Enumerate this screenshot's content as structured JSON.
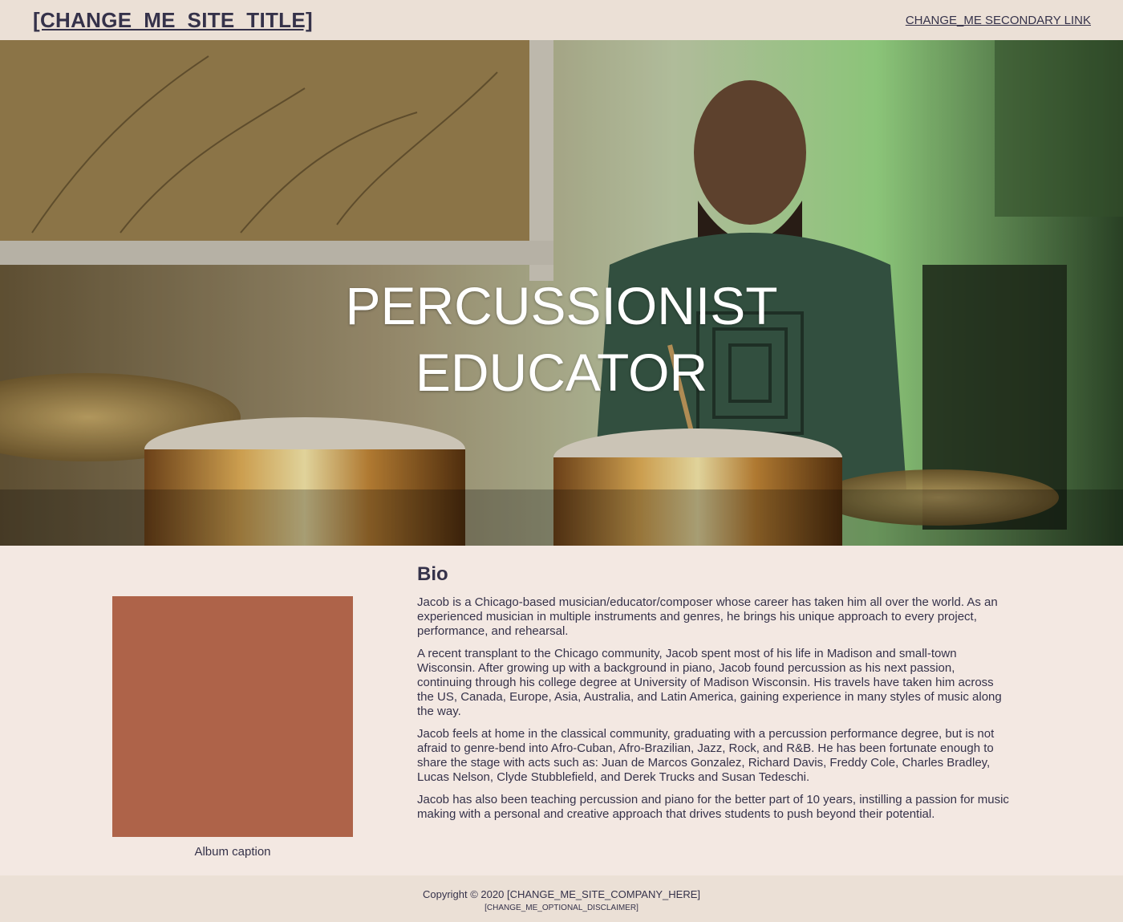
{
  "header": {
    "site_title": "[CHANGE_ME_SITE_TITLE]",
    "secondary_link": "CHANGE_ME SECONDARY LINK"
  },
  "hero": {
    "line1": "PERCUSSIONIST",
    "line2": "EDUCATOR"
  },
  "album": {
    "color": "#ae6349",
    "caption": "Album caption"
  },
  "bio": {
    "heading": "Bio",
    "paragraphs": [
      "Jacob is a Chicago-based musician/educator/composer whose career has taken him all over the world. As an experienced musician in multiple instruments and genres, he brings his unique approach to every project, performance, and rehearsal.",
      "A recent transplant to the Chicago community, Jacob spent most of his life in Madison and small-town Wisconsin. After growing up with a background in piano, Jacob found percussion as his next passion, continuing through his college degree at University of Madison Wisconsin. His travels have taken him across the US, Canada, Europe, Asia, Australia, and Latin America, gaining experience in many styles of music along the way.",
      "Jacob feels at home in the classical community, graduating with a percussion performance degree, but is not afraid to genre-bend into Afro-Cuban, Afro-Brazilian, Jazz, Rock, and R&B. He has been fortunate enough to share the stage with acts such as: Juan de Marcos Gonzalez, Richard Davis, Freddy Cole, Charles Bradley, Lucas Nelson, Clyde Stubblefield, and Derek Trucks and Susan Tedeschi.",
      "Jacob has also been teaching percussion and piano for the better part of 10 years, instilling a passion for music making with a personal and creative approach that drives students to push beyond their potential."
    ]
  },
  "footer": {
    "copyright": "Copyright © 2020 [CHANGE_ME_SITE_COMPANY_HERE]",
    "disclaimer": "[CHANGE_ME_OPTIONAL_DISCLAIMER]"
  },
  "colors": {
    "header_bg": "#ebe0d6",
    "page_bg": "#f3e8e2",
    "text": "#35324a",
    "album": "#ae6349"
  }
}
